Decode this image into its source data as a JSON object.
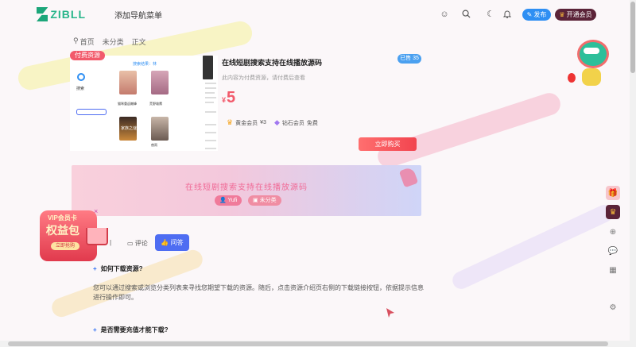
{
  "header": {
    "logo_text": "ZIBLL",
    "nav_item": "添加导航菜单",
    "publish_label": "发布",
    "vip_label": "开通会员"
  },
  "breadcrumb": [
    "首页",
    "未分类",
    "正文"
  ],
  "preview": {
    "tag": "付费资源",
    "search_label": "搜索",
    "result_title": "搜索结果：林",
    "poster_labels": [
      "猫咪重返巅峰",
      "荒野雄鹰",
      "家族之谜",
      "夜雨"
    ]
  },
  "resource": {
    "title": "在线短剧搜索支持在线播放源码",
    "sold_badge": "已售 35",
    "description": "此内容为付费资源，请付费后查看",
    "currency": "¥",
    "price": "5",
    "gold_member": "黄金会员",
    "gold_price": "¥3",
    "diamond_member": "钻石会员",
    "diamond_price": "免费",
    "buy_label": "立即购买"
  },
  "banner": {
    "title": "在线短剧搜索支持在线播放源码",
    "author_pill": "Yufi",
    "category_pill": "未分类"
  },
  "tabs": {
    "comments": "评论",
    "qa": "问答"
  },
  "faq": [
    {
      "q": "如何下载资源?",
      "a": "您可以通过搜索或浏览分类列表来寻找您期望下载的资源。随后，点击资源介绍页右侧的下载链接按钮，依据提示信息进行操作即可。"
    },
    {
      "q": "是否需要充值才能下载?",
      "a": ""
    }
  ],
  "vipcard": {
    "line1": "VIP会员卡",
    "line2": "权益包",
    "cta": "立即抢购"
  },
  "colors": {
    "accent": "#4e6df2",
    "price": "#f25a6b",
    "brand": "#1ca67a",
    "vip_bg": "#5b2338"
  }
}
